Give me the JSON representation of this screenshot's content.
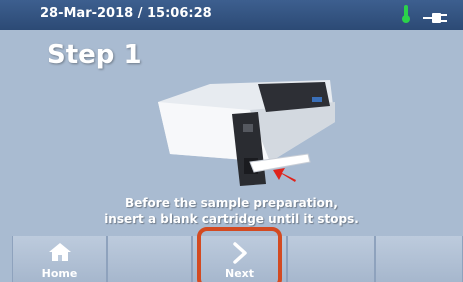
{
  "status": {
    "datetime": "28-Mar-2018 / 15:06:28",
    "icons": [
      "thermometer-icon",
      "power-plug-icon"
    ],
    "thermometer_color": "#2bd24a"
  },
  "step": {
    "title": "Step 1",
    "instruction_lines": [
      "Before the sample preparation,",
      "insert a blank cartridge until it stops."
    ]
  },
  "nav": {
    "buttons": [
      {
        "label": "Home",
        "icon": "home-icon"
      },
      {
        "label": "Next",
        "icon": "chevron-right-icon",
        "highlighted": true
      },
      {
        "label": ""
      },
      {
        "label": ""
      }
    ],
    "highlight_color": "#d34a21"
  },
  "colors": {
    "background": "#a9bbd1",
    "status_bar": "#2c4a75",
    "arrow": "#e0231b"
  }
}
